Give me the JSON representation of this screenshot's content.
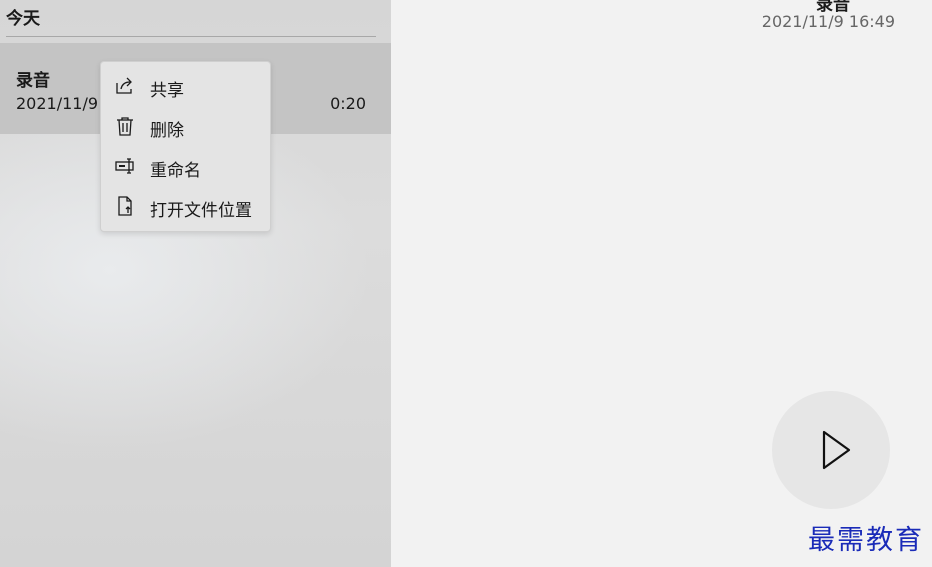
{
  "sidebar": {
    "group_header": "今天",
    "recording": {
      "name": "录音",
      "date": "2021/11/9",
      "duration": "0:20"
    }
  },
  "context_menu": {
    "items": [
      {
        "label": "共享",
        "icon": "share-icon"
      },
      {
        "label": "删除",
        "icon": "trash-icon"
      },
      {
        "label": "重命名",
        "icon": "rename-icon"
      },
      {
        "label": "打开文件位置",
        "icon": "open-file-location-icon"
      }
    ]
  },
  "main": {
    "title": "录音",
    "datetime": "2021/11/9 16:49",
    "play_icon": "play-icon"
  },
  "watermark": "最需教育"
}
